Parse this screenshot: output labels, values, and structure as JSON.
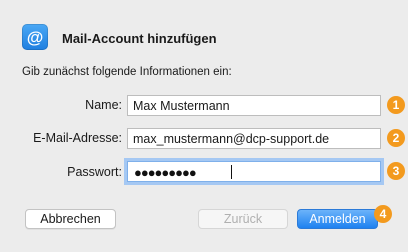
{
  "dialog": {
    "title": "Mail-Account hinzufügen",
    "subtitle": "Gib zunächst folgende Informationen ein:",
    "app_icon_glyph": "@",
    "app_icon": "mail-at-icon"
  },
  "fields": {
    "name": {
      "label": "Name:",
      "value": "Max Mustermann",
      "badge": "1"
    },
    "email": {
      "label": "E-Mail-Adresse:",
      "value": "max_mustermann@dcp-support.de",
      "badge": "2"
    },
    "password": {
      "label": "Passwort:",
      "masked_value": "●●●●●●●●●",
      "badge": "3"
    }
  },
  "buttons": {
    "cancel": "Abbrechen",
    "back": "Zurück",
    "add": "Anmelden",
    "add_badge": "4"
  },
  "colors": {
    "accent": "#1e81f0",
    "badge": "#f39a1e",
    "background": "#ececec"
  }
}
